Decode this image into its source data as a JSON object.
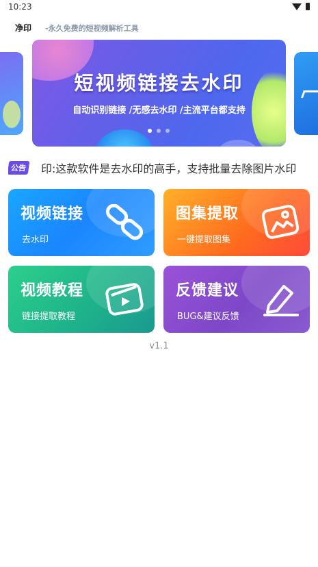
{
  "status_bar": {
    "time": "10:23",
    "wifi_icon": "wifi-icon",
    "battery_icon": "battery-icon"
  },
  "header": {
    "title": "净印",
    "subtitle": "-永久免费的短视频解析工具"
  },
  "banner": {
    "title": "短视频链接去水印",
    "subtitle": "自动识别链接 /无感去水印 /主流平台都支持",
    "active_slide": 1,
    "slide_count": 3
  },
  "notice": {
    "tag": "公告",
    "text": "印:这款软件是去水印的高手，支持批量去除图片水印"
  },
  "cards": [
    {
      "title": "视频链接",
      "subtitle": "去水印",
      "icon": "link-icon",
      "color": "#1a98ff"
    },
    {
      "title": "图集提取",
      "subtitle": "一键提取图集",
      "icon": "image-icon",
      "color": "#ff7a22"
    },
    {
      "title": "视频教程",
      "subtitle": "链接提取教程",
      "icon": "play-video-icon",
      "color": "#1fbf8a"
    },
    {
      "title": "反馈建议",
      "subtitle": "BUG&建议反馈",
      "icon": "edit-pen-icon",
      "color": "#8a4ed0"
    }
  ],
  "version": "v1.1"
}
